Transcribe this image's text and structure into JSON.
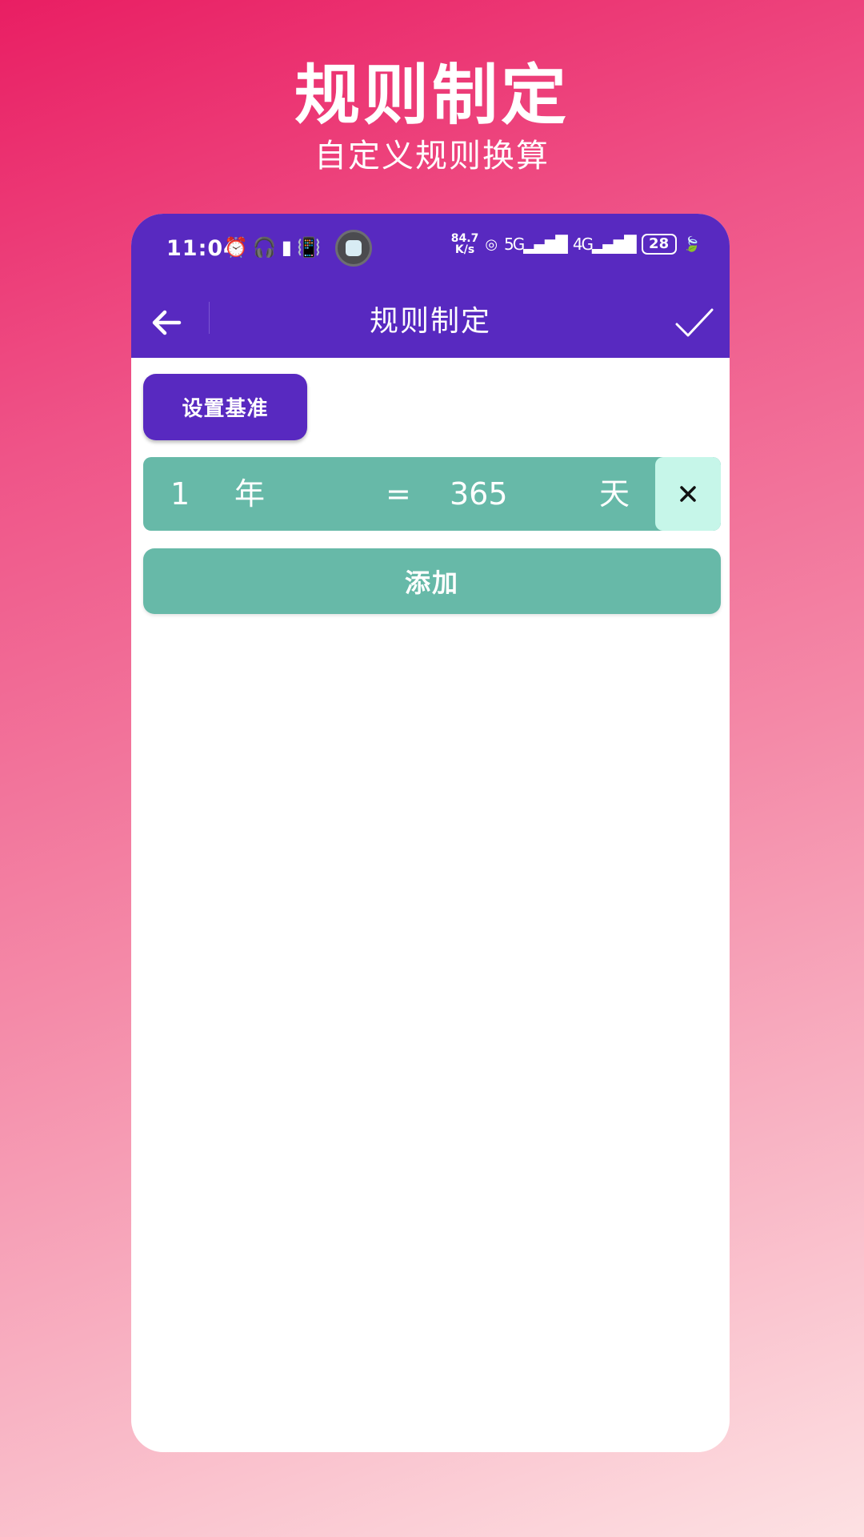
{
  "promo": {
    "title": "规则制定",
    "subtitle": "自定义规则换算"
  },
  "status_bar": {
    "time": "11:04",
    "left_icons": [
      "alarm-icon",
      "headphones-icon",
      "battery-small-icon",
      "vibrate-icon"
    ],
    "network_speed_value": "84.7",
    "network_speed_unit": "K/s",
    "network_5g": "5G",
    "network_4g": "4G",
    "battery_level": "28"
  },
  "toolbar": {
    "title": "规则制定",
    "back_icon": "arrow-left-icon",
    "confirm_icon": "check-icon"
  },
  "main": {
    "set_base_label": "设置基准",
    "rules": [
      {
        "left_value": "1",
        "left_unit": "年",
        "equals": "=",
        "right_value": "365",
        "right_unit": "天",
        "delete_label": "×"
      }
    ],
    "add_label": "添加"
  },
  "colors": {
    "primary": "#5829c0",
    "teal": "#67b9a8",
    "delete_bg": "#c6f6e9",
    "background_gradient_start": "#e91e63",
    "background_gradient_end": "#fde1e3"
  }
}
